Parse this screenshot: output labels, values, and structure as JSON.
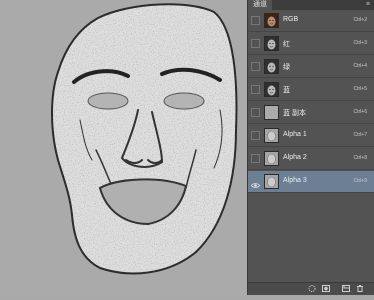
{
  "panel": {
    "tab_label": "通道",
    "menu_icon": "panel-menu-icon"
  },
  "channels": [
    {
      "name": "RGB",
      "shortcut": "Ctrl+2",
      "visible": false,
      "selected": false,
      "thumb": "color-face"
    },
    {
      "name": "红",
      "shortcut": "Ctrl+3",
      "visible": false,
      "selected": false,
      "thumb": "gray-face"
    },
    {
      "name": "绿",
      "shortcut": "Ctrl+4",
      "visible": false,
      "selected": false,
      "thumb": "gray-face"
    },
    {
      "name": "蓝",
      "shortcut": "Ctrl+5",
      "visible": false,
      "selected": false,
      "thumb": "gray-face"
    },
    {
      "name": "蓝 副本",
      "shortcut": "Ctrl+6",
      "visible": false,
      "selected": false,
      "thumb": "gray-blank"
    },
    {
      "name": "Alpha 1",
      "shortcut": "Ctrl+7",
      "visible": false,
      "selected": false,
      "thumb": "sketch"
    },
    {
      "name": "Alpha 2",
      "shortcut": "Ctrl+8",
      "visible": false,
      "selected": false,
      "thumb": "sketch"
    },
    {
      "name": "Alpha 3",
      "shortcut": "Ctrl+9",
      "visible": true,
      "selected": true,
      "thumb": "sketch"
    }
  ],
  "bottom_icons": [
    "load-selection-icon",
    "save-selection-icon",
    "new-channel-icon",
    "delete-channel-icon"
  ],
  "colors": {
    "selected_row": "#6c7f95",
    "panel_bg": "#535353",
    "canvas_bg": "#aaaaaa"
  }
}
